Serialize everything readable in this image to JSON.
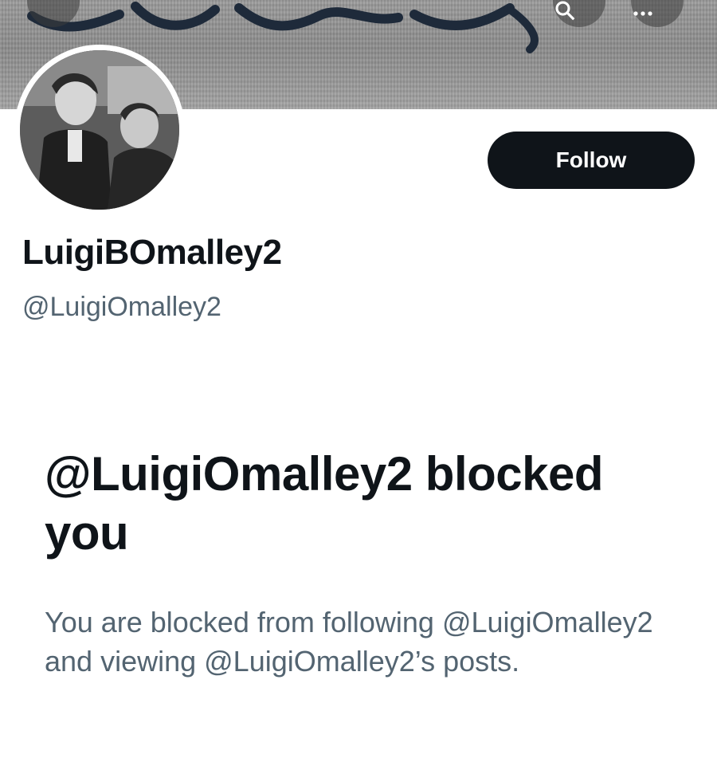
{
  "profile": {
    "display_name": "LuigiBOmalley2",
    "handle": "@LuigiOmalley2",
    "follow_label": "Follow"
  },
  "blocked": {
    "title": "@LuigiOmalley2 blocked you",
    "description": "You are blocked from following @LuigiOmalley2 and viewing @LuigiOmalley2’s posts."
  },
  "icons": {
    "back": "arrow-left-icon",
    "search": "search-icon",
    "more": "more-icon"
  },
  "colors": {
    "button_bg": "#0f1419",
    "text_primary": "#0f1419",
    "text_secondary": "#536471"
  }
}
